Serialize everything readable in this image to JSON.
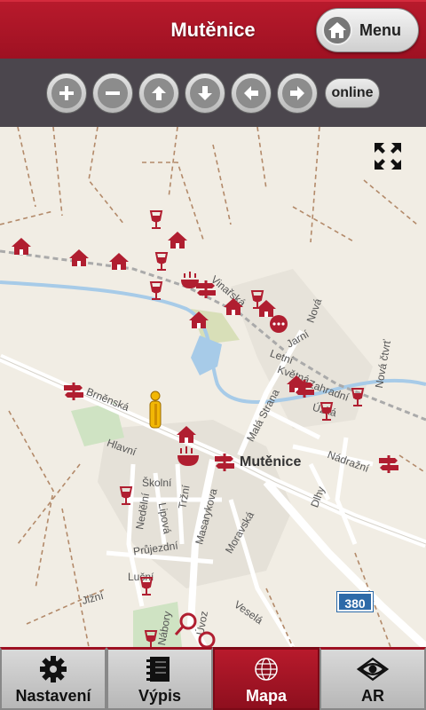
{
  "header": {
    "title": "Mutěnice",
    "menu_label": "Menu"
  },
  "toolbar": {
    "buttons": [
      {
        "name": "zoom-in",
        "icon": "plus-icon"
      },
      {
        "name": "zoom-out",
        "icon": "minus-icon"
      },
      {
        "name": "pan-up",
        "icon": "arrow-up-icon"
      },
      {
        "name": "pan-down",
        "icon": "arrow-down-icon"
      },
      {
        "name": "pan-left",
        "icon": "arrow-left-icon"
      },
      {
        "name": "pan-right",
        "icon": "arrow-right-icon"
      }
    ],
    "online_label": "online"
  },
  "map": {
    "town_label": "Mutěnice",
    "road_number": "380",
    "street_labels": [
      "Brněnská",
      "Vinařská",
      "Jarní",
      "Letní",
      "Květná",
      "Zahradní",
      "Úzká",
      "Nová čtvrť",
      "Nádražní",
      "Malá Strana",
      "Nová",
      "Dlhy",
      "Nedělní",
      "Školní",
      "Tržní",
      "Lipová",
      "Masarykova",
      "Moravská",
      "Průjezdní",
      "Luční",
      "Jižní",
      "Veselá",
      "Úvoz",
      "Hlavní",
      "Nábory"
    ]
  },
  "tabs": [
    {
      "label": "Nastavení",
      "icon": "gear-icon",
      "active": false
    },
    {
      "label": "Výpis",
      "icon": "list-icon",
      "active": false
    },
    {
      "label": "Mapa",
      "icon": "globe-icon",
      "active": true
    },
    {
      "label": "AR",
      "icon": "ar-eye-icon",
      "active": false
    }
  ],
  "colors": {
    "accent": "#9e1122",
    "toolbar": "#4b464d",
    "map_bg": "#f1ede4",
    "poi": "#b01e30",
    "road_shield": "#2d6aa8"
  }
}
